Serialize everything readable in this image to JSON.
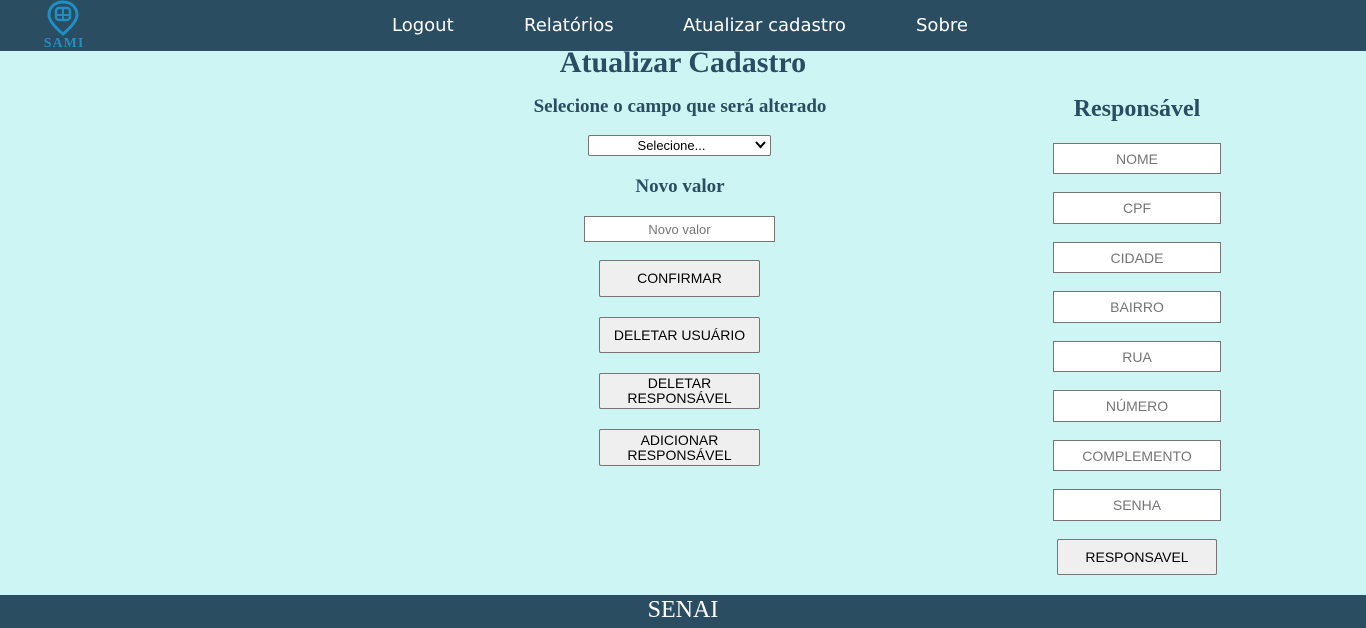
{
  "header": {
    "logo_text": "SAMI",
    "nav": [
      "Logout",
      "Relatórios",
      "Atualizar cadastro",
      "Sobre"
    ]
  },
  "main": {
    "title": "Atualizar Cadastro",
    "select_heading": "Selecione o campo que será alterado",
    "select_value": "Selecione...",
    "new_value_heading": "Novo valor",
    "new_value_placeholder": "Novo valor",
    "buttons": {
      "confirm": "CONFIRMAR",
      "delete_user": "DELETAR USUÁRIO",
      "delete_responsible": "DELETAR RESPONSÁVEL",
      "add_responsible": "ADICIONAR RESPONSÁVEL"
    }
  },
  "responsible": {
    "heading": "Responsável",
    "fields": [
      "NOME",
      "CPF",
      "CIDADE",
      "BAIRRO",
      "RUA",
      "NÚMERO",
      "COMPLEMENTO",
      "SENHA"
    ],
    "submit": "RESPONSAVEL"
  },
  "footer": {
    "text": "SENAI"
  },
  "colors": {
    "header_bg": "#2a4d62",
    "page_bg": "#ccf5f3",
    "logo": "#1f8fc4"
  }
}
